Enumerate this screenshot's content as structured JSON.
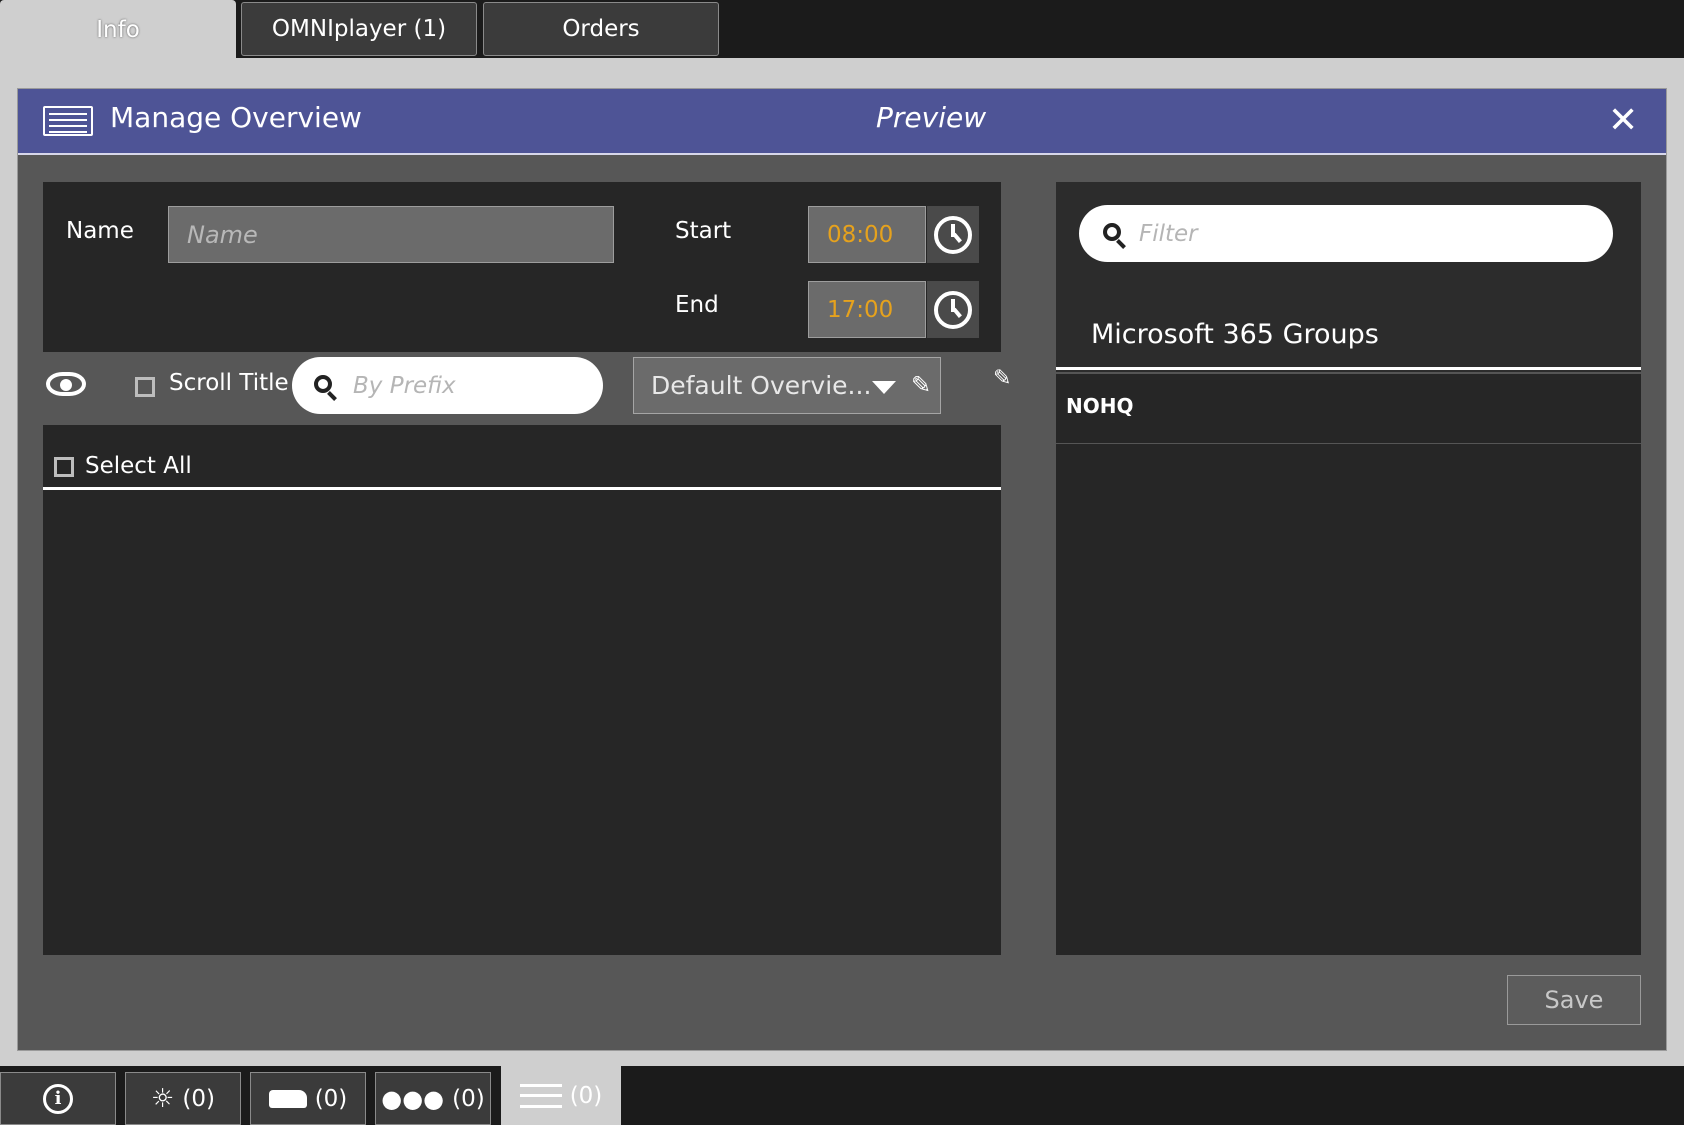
{
  "top_tabs": {
    "info": "Info",
    "omniplayer": "OMNIplayer (1)",
    "orders": "Orders"
  },
  "dialog": {
    "title": "Manage Overview",
    "preview": "Preview",
    "close": "✕"
  },
  "form": {
    "name_label": "Name",
    "name_placeholder": "Name",
    "start_label": "Start",
    "start_value": "08:00",
    "end_label": "End",
    "end_value": "17:00"
  },
  "toolbar": {
    "scroll_title_label": "Scroll Title",
    "prefix_placeholder": "By Prefix",
    "overview_select": "Default Overvie..."
  },
  "list": {
    "select_all_label": "Select All"
  },
  "right_panel": {
    "filter_placeholder": "Filter",
    "section_title": "Microsoft 365 Groups",
    "items": [
      "NOHQ"
    ]
  },
  "footer": {
    "save_label": "Save"
  },
  "bottom_tabs": {
    "alarms_count": "(0)",
    "vehicles_count": "(0)",
    "groups_count": "(0)",
    "overview_count": "(0)"
  },
  "colors": {
    "header_bg": "#4e5496",
    "time_text": "#e6a21d",
    "panel_bg": "#262626"
  }
}
